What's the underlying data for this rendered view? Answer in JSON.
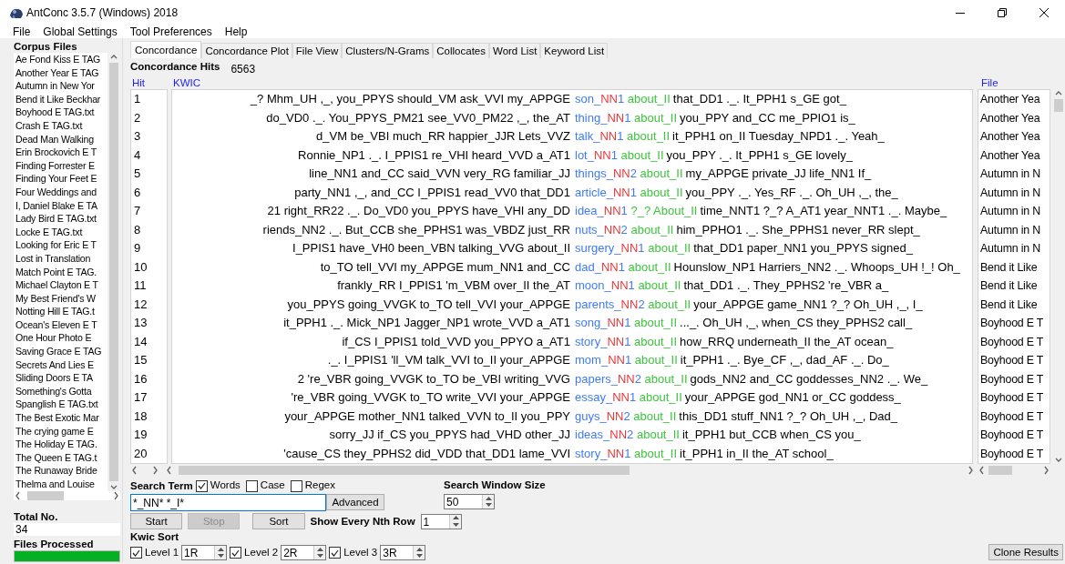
{
  "window": {
    "title": "AntConc 3.5.7 (Windows) 2018"
  },
  "menu": [
    "File",
    "Global Settings",
    "Tool Preferences",
    "Help"
  ],
  "corpus": {
    "heading": "Corpus Files",
    "files": [
      "Ae Fond Kiss E TAG",
      "Another Year E TAG",
      "Autumn in New Yor",
      "Bend it Like Beckhar",
      "Boyhood E TAG.txt",
      "Crash E TAG.txt",
      "Dead Man Walking",
      "Erin Brockovich E T",
      "Finding Forrester E",
      "Finding Your Feet E",
      "Four Weddings and",
      "I, Daniel Blake E TA",
      "Lady Bird E TAG.txt",
      "Locke E TAG.txt",
      "Looking for Eric E T",
      "Lost in Translation",
      "Match Point E TAG.",
      "Michael Clayton E T",
      "My Best Friend's W",
      "Notting Hill E TAG.t",
      "Ocean's Eleven E T",
      "One Hour Photo E",
      "Saving Grace E TAG",
      "Secrets And Lies E",
      "Sliding Doors E TA",
      "Something's Gotta",
      "Spanglish E TAG.txt",
      "The Best Exotic Mar",
      "The crying game E",
      "The Holiday E TAG.",
      "The Queen E TAG.t",
      "The Runaway Bride",
      "Thelma and Louise"
    ],
    "total_label": "Total No.",
    "total": "34",
    "processed_label": "Files Processed",
    "progress": {
      "level": 1
    }
  },
  "tabs": [
    {
      "label": "Concordance",
      "selected": true
    },
    {
      "label": "Concordance Plot",
      "selected": false
    },
    {
      "label": "File View",
      "selected": false
    },
    {
      "label": "Clusters/N-Grams",
      "selected": false
    },
    {
      "label": "Collocates",
      "selected": false
    },
    {
      "label": "Word List",
      "selected": false
    },
    {
      "label": "Keyword List",
      "selected": false
    }
  ],
  "hits_label": "Concordance Hits",
  "hits": "6563",
  "columns": [
    "Hit",
    "KWIC",
    "File"
  ],
  "rows": [
    {
      "hit": "1",
      "left": "_? Mhm_UH ,_, you_PPYS should_VM ask_VVI my_APPGE",
      "key": [
        {
          "text": "son_",
          "color": "#3f7bf5"
        },
        {
          "text": "NN",
          "color": "#e8383a"
        },
        {
          "text": "1",
          "color": "#3f7bf5"
        },
        {
          "text": " about_II",
          "color": "#3cc43c"
        }
      ],
      "right": "that_DD1 ._. It_PPH1 s_GE got_",
      "file": "Another Yea"
    },
    {
      "hit": "2",
      "left": "do_VD0 ._. You_PPYS_PM21 see_VV0_PM22 ,_, the_AT",
      "key": [
        {
          "text": "thing_",
          "color": "#3f7bf5"
        },
        {
          "text": "NN",
          "color": "#e8383a"
        },
        {
          "text": "1",
          "color": "#3f7bf5"
        },
        {
          "text": " about_II",
          "color": "#3cc43c"
        }
      ],
      "right": "you_PPY and_CC me_PPIO1 is_",
      "file": "Another Yea"
    },
    {
      "hit": "3",
      "left": "d_VM be_VBI much_RR happier_JJR Lets_VVZ",
      "key": [
        {
          "text": "talk_",
          "color": "#3f7bf5"
        },
        {
          "text": "NN",
          "color": "#e8383a"
        },
        {
          "text": "1",
          "color": "#3f7bf5"
        },
        {
          "text": " about_II",
          "color": "#3cc43c"
        }
      ],
      "right": "it_PPH1 on_II Tuesday_NPD1 ._. Yeah_",
      "file": "Another Yea"
    },
    {
      "hit": "4",
      "left": "Ronnie_NP1 ._. I_PPIS1 re_VHI heard_VVD a_AT1",
      "key": [
        {
          "text": "lot_",
          "color": "#3f7bf5"
        },
        {
          "text": "NN",
          "color": "#e8383a"
        },
        {
          "text": "1",
          "color": "#3f7bf5"
        },
        {
          "text": " about_II",
          "color": "#3cc43c"
        }
      ],
      "right": "you_PPY ._. It_PPH1 s_GE lovely_",
      "file": "Another Yea"
    },
    {
      "hit": "5",
      "left": "line_NN1 and_CC said_VVN very_RG familiar_JJ",
      "key": [
        {
          "text": "things_",
          "color": "#3f7bf5"
        },
        {
          "text": "NN",
          "color": "#e8383a"
        },
        {
          "text": "2",
          "color": "#3f7bf5"
        },
        {
          "text": " about_II",
          "color": "#3cc43c"
        }
      ],
      "right": "my_APPGE private_JJ life_NN1 If_",
      "file": "Autumn in N"
    },
    {
      "hit": "6",
      "left": "party_NN1 ,_, and_CC I_PPIS1 read_VV0 that_DD1",
      "key": [
        {
          "text": "article_",
          "color": "#3f7bf5"
        },
        {
          "text": "NN",
          "color": "#e8383a"
        },
        {
          "text": "1",
          "color": "#3f7bf5"
        },
        {
          "text": " about_II",
          "color": "#3cc43c"
        }
      ],
      "right": "you_PPY ._. Yes_RF ._. Oh_UH ,_, the_",
      "file": "Autumn in N"
    },
    {
      "hit": "7",
      "left": "21 right_RR22 ._. Do_VD0 you_PPYS have_VHI any_DD",
      "key": [
        {
          "text": "idea_",
          "color": "#3f7bf5"
        },
        {
          "text": "NN",
          "color": "#e8383a"
        },
        {
          "text": "1",
          "color": "#3f7bf5"
        },
        {
          "text": " ?_? About_II",
          "color": "#3cc43c"
        }
      ],
      "right": "time_NNT1 ?_? A_AT1 year_NNT1 ._. Maybe_",
      "file": "Autumn in N"
    },
    {
      "hit": "8",
      "left": "riends_NN2 ._. But_CCB she_PPHS1 was_VBDZ just_RR",
      "key": [
        {
          "text": "nuts_",
          "color": "#3f7bf5"
        },
        {
          "text": "NN",
          "color": "#e8383a"
        },
        {
          "text": "2",
          "color": "#3f7bf5"
        },
        {
          "text": " about_II",
          "color": "#3cc43c"
        }
      ],
      "right": "him_PPHO1 ._. She_PPHS1 never_RR slept_",
      "file": "Autumn in N"
    },
    {
      "hit": "9",
      "left": "I_PPIS1 have_VH0 been_VBN talking_VVG about_II",
      "key": [
        {
          "text": "surgery_",
          "color": "#3f7bf5"
        },
        {
          "text": "NN",
          "color": "#e8383a"
        },
        {
          "text": "1",
          "color": "#3f7bf5"
        },
        {
          "text": " about_II",
          "color": "#3cc43c"
        }
      ],
      "right": "that_DD1 paper_NN1 you_PPYS signed_",
      "file": "Autumn in N"
    },
    {
      "hit": "10",
      "left": "to_TO tell_VVI my_APPGE mum_NN1 and_CC",
      "key": [
        {
          "text": "dad_",
          "color": "#3f7bf5"
        },
        {
          "text": "NN",
          "color": "#e8383a"
        },
        {
          "text": "1",
          "color": "#3f7bf5"
        },
        {
          "text": " about_II",
          "color": "#3cc43c"
        }
      ],
      "right": "Hounslow_NP1 Harriers_NN2 ._. Whoops_UH !_! Oh_",
      "file": "Bend it Like"
    },
    {
      "hit": "11",
      "left": "frankly_RR I_PPIS1 'm_VBM over_II the_AT",
      "key": [
        {
          "text": "moon_",
          "color": "#3f7bf5"
        },
        {
          "text": "NN",
          "color": "#e8383a"
        },
        {
          "text": "1",
          "color": "#3f7bf5"
        },
        {
          "text": " about_II",
          "color": "#3cc43c"
        }
      ],
      "right": "that_DD1 ._. They_PPHS2 're_VBR a_",
      "file": "Bend it Like"
    },
    {
      "hit": "12",
      "left": "you_PPYS going_VVGK to_TO tell_VVI your_APPGE",
      "key": [
        {
          "text": "parents_",
          "color": "#3f7bf5"
        },
        {
          "text": "NN",
          "color": "#e8383a"
        },
        {
          "text": "2",
          "color": "#3f7bf5"
        },
        {
          "text": " about_II",
          "color": "#3cc43c"
        }
      ],
      "right": "your_APPGE game_NN1 ?_? Oh_UH ,_, I_",
      "file": "Bend it Like"
    },
    {
      "hit": "13",
      "left": "it_PPH1 ._. Mick_NP1 Jagger_NP1 wrote_VVD a_AT1",
      "key": [
        {
          "text": "song_",
          "color": "#3f7bf5"
        },
        {
          "text": "NN",
          "color": "#e8383a"
        },
        {
          "text": "1",
          "color": "#3f7bf5"
        },
        {
          "text": " about_II",
          "color": "#3cc43c"
        }
      ],
      "right": "..._. Oh_UH ,_, when_CS they_PPHS2 call_",
      "file": "Boyhood E T"
    },
    {
      "hit": "14",
      "left": "if_CS I_PPIS1 told_VVD you_PPYO a_AT1",
      "key": [
        {
          "text": "story_",
          "color": "#3f7bf5"
        },
        {
          "text": "NN",
          "color": "#e8383a"
        },
        {
          "text": "1",
          "color": "#3f7bf5"
        },
        {
          "text": " about_II",
          "color": "#3cc43c"
        }
      ],
      "right": "how_RRQ underneath_II the_AT ocean_",
      "file": "Boyhood E T"
    },
    {
      "hit": "15",
      "left": "._. I_PPIS1 'll_VM talk_VVI to_II your_APPGE",
      "key": [
        {
          "text": "mom_",
          "color": "#3f7bf5"
        },
        {
          "text": "NN",
          "color": "#e8383a"
        },
        {
          "text": "1",
          "color": "#3f7bf5"
        },
        {
          "text": " about_II",
          "color": "#3cc43c"
        }
      ],
      "right": "it_PPH1 ._. Bye_CF ,_, dad_AF ._. Do_",
      "file": "Boyhood E T"
    },
    {
      "hit": "16",
      "left": "2 're_VBR going_VVGK to_TO be_VBI writing_VVG",
      "key": [
        {
          "text": "papers_",
          "color": "#3f7bf5"
        },
        {
          "text": "NN",
          "color": "#e8383a"
        },
        {
          "text": "2",
          "color": "#3f7bf5"
        },
        {
          "text": " about_II",
          "color": "#3cc43c"
        }
      ],
      "right": "gods_NN2 and_CC goddesses_NN2 ._. We_",
      "file": "Boyhood E T"
    },
    {
      "hit": "17",
      "left": "'re_VBR going_VVGK to_TO write_VVI your_APPGE",
      "key": [
        {
          "text": "essay_",
          "color": "#3f7bf5"
        },
        {
          "text": "NN",
          "color": "#e8383a"
        },
        {
          "text": "1",
          "color": "#3f7bf5"
        },
        {
          "text": " about_II",
          "color": "#3cc43c"
        }
      ],
      "right": "your_APPGE god_NN1 or_CC goddess_",
      "file": "Boyhood E T"
    },
    {
      "hit": "18",
      "left": "your_APPGE mother_NN1 talked_VVN to_II you_PPY",
      "key": [
        {
          "text": "guys_",
          "color": "#3f7bf5"
        },
        {
          "text": "NN",
          "color": "#e8383a"
        },
        {
          "text": "2",
          "color": "#3f7bf5"
        },
        {
          "text": " about_II",
          "color": "#3cc43c"
        }
      ],
      "right": "this_DD1 stuff_NN1 ?_? Oh_UH ,_, Dad_",
      "file": "Boyhood E T"
    },
    {
      "hit": "19",
      "left": "sorry_JJ if_CS you_PPYS had_VHD other_JJ",
      "key": [
        {
          "text": "ideas_",
          "color": "#3f7bf5"
        },
        {
          "text": "NN",
          "color": "#e8383a"
        },
        {
          "text": "2",
          "color": "#3f7bf5"
        },
        {
          "text": " about_II",
          "color": "#3cc43c"
        }
      ],
      "right": "it_PPH1 but_CCB when_CS you_",
      "file": "Boyhood E T"
    },
    {
      "hit": "20",
      "left": "'cause_CS they_PPHS2 did_VDD that_DD1 lame_VVI",
      "key": [
        {
          "text": "story_",
          "color": "#3f7bf5"
        },
        {
          "text": "NN",
          "color": "#e8383a"
        },
        {
          "text": "1",
          "color": "#3f7bf5"
        },
        {
          "text": " about_II",
          "color": "#3cc43c"
        }
      ],
      "right": "it_PPH1 in_II the_AT school_",
      "file": "Boyhood E T"
    }
  ],
  "search": {
    "label": "Search Term",
    "options": [
      {
        "label": "Words",
        "checked": true
      },
      {
        "label": "Case",
        "checked": false
      },
      {
        "label": "Regex",
        "checked": false
      }
    ],
    "value": "*_NN* *_I*",
    "advanced": "Advanced"
  },
  "window_size": {
    "label": "Search Window Size",
    "value": "50"
  },
  "buttons": [
    {
      "label": "Start",
      "disabled": false
    },
    {
      "label": "Stop",
      "disabled": true
    },
    {
      "label": "Sort",
      "disabled": false
    }
  ],
  "nth_row": {
    "label": "Show Every Nth Row",
    "value": "1"
  },
  "kwic_sort": {
    "label": "Kwic Sort",
    "levels": [
      {
        "label": "Level 1",
        "checked": true,
        "value": "1R"
      },
      {
        "label": "Level 2",
        "checked": true,
        "value": "2R"
      },
      {
        "label": "Level 3",
        "checked": true,
        "value": "3R"
      }
    ]
  },
  "clone": "Clone Results"
}
